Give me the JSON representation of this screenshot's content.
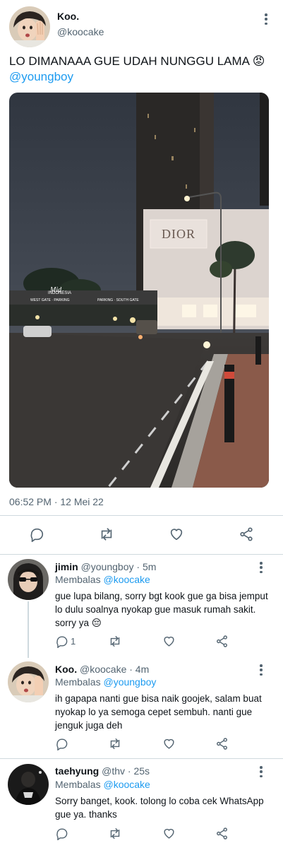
{
  "main_tweet": {
    "author_name": "Koo.",
    "author_handle": "@koocake",
    "text": "LO DIMANAAA GUE UDAH NUNGGU LAMA 😡",
    "mention": "@youngboy",
    "timestamp": "06:52 PM · 12 Mei 22",
    "photo_sign": "DIOR",
    "photo_sign2": "INDONESIA"
  },
  "replies": [
    {
      "name": "jimin",
      "handle": "@youngboy",
      "time": "· 5m",
      "replying_label": "Membalas",
      "replying_to": "@koocake",
      "text": "gue lupa bilang, sorry bgt kook gue ga bisa jemput lo dulu soalnya nyokap gue masuk rumah sakit. sorry ya 😔",
      "reply_count": "1"
    },
    {
      "name": "Koo.",
      "handle": "@koocake",
      "time": "· 4m",
      "replying_label": "Membalas",
      "replying_to": "@youngboy",
      "text": "ih gapapa nanti gue bisa naik goojek, salam buat nyokap lo ya semoga cepet sembuh. nanti gue jenguk juga deh",
      "reply_count": ""
    },
    {
      "name": "taehyung",
      "handle": "@thv",
      "time": "· 25s",
      "replying_label": "Membalas",
      "replying_to": "@koocake",
      "text": "Sorry banget, kook. tolong lo coba cek WhatsApp gue ya. thanks",
      "reply_count": ""
    }
  ],
  "icons": [
    "reply-icon",
    "retweet-icon",
    "like-icon",
    "share-icon",
    "more-icon"
  ],
  "colors": {
    "accent": "#1d9bf0",
    "muted": "#536471",
    "divider": "#cfd9de"
  }
}
